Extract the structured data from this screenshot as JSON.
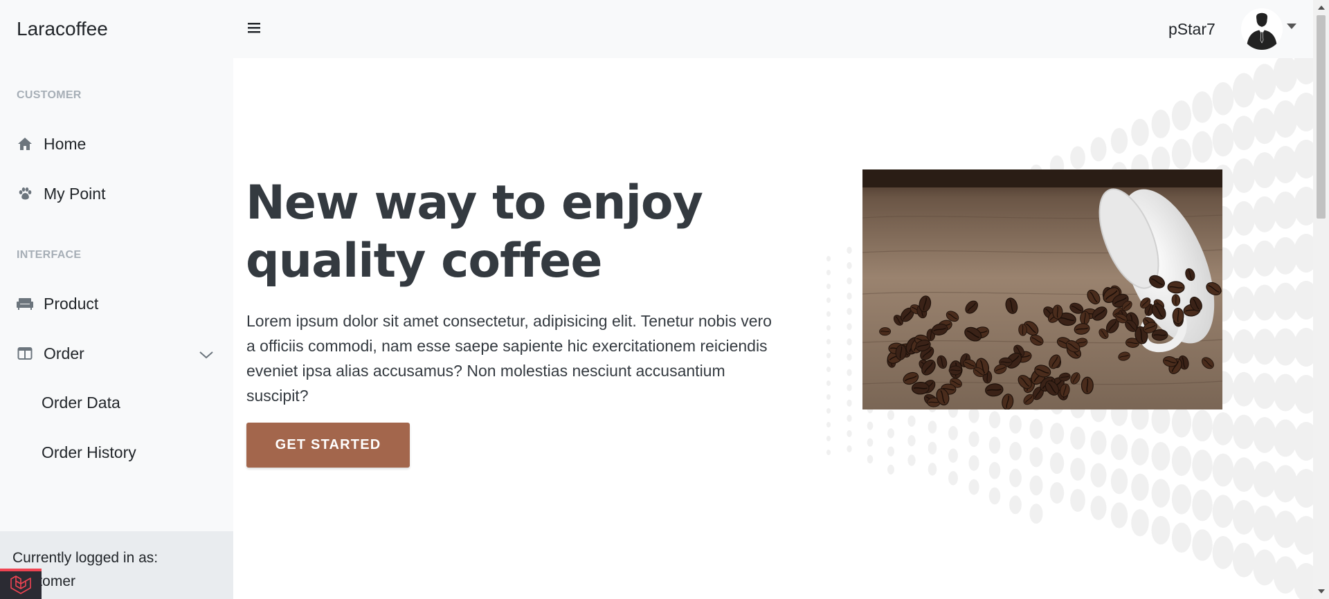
{
  "app": {
    "brand": "Laracoffee"
  },
  "sidebar": {
    "headings": {
      "customer": "CUSTOMER",
      "interface": "INTERFACE"
    },
    "items": [
      {
        "label": "Home",
        "icon": "home-icon"
      },
      {
        "label": "My Point",
        "icon": "paw-icon"
      },
      {
        "label": "Product",
        "icon": "couch-icon"
      },
      {
        "label": "Order",
        "icon": "columns-icon",
        "expanded": true
      }
    ],
    "order_sub": [
      {
        "label": "Order Data"
      },
      {
        "label": "Order History"
      }
    ],
    "footer": {
      "caption": "Currently logged in as:",
      "role": "Customer"
    }
  },
  "topbar": {
    "username": "pStar7",
    "toggle_icon": "hamburger-icon",
    "avatar_icon": "user-silhouette-icon"
  },
  "hero": {
    "title_line1": "New way to enjoy",
    "title_line2": "quality coffee",
    "text": "Lorem ipsum dolor sit amet consectetur, adipisicing elit. Tenetur nobis vero a officiis commodi, nam esse saepe sapiente hic exercitationem reiciendis eveniet ipsa alias accusamus? Non molestias nesciunt accusantium suscipit?",
    "cta_label": "GET STARTED"
  },
  "colors": {
    "accent": "#a3664c",
    "sidebar_bg": "#f8f9fa",
    "heading": "#343a40",
    "laravel": "#ef4452"
  }
}
